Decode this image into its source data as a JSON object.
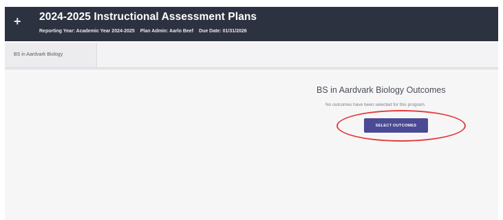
{
  "header": {
    "add_icon": "plus-icon",
    "title": "2024-2025 Instructional Assessment Plans",
    "reporting_year": "Reporting Year: Academic Year 2024-2025",
    "plan_admin": "Plan Admin: Aarlo Beef",
    "due_date": "Due Date: 01/31/2026"
  },
  "tabs": [
    {
      "label": "BS in Aardvark Biology"
    }
  ],
  "main": {
    "outcomes_title": "BS in Aardvark Biology Outcomes",
    "empty_message": "No outcomes have been selected for this program.",
    "select_button": "SELECT OUTCOMES"
  },
  "colors": {
    "header_bg": "#2d3240",
    "button_bg": "#4b4a95",
    "highlight": "#e53a3a"
  }
}
